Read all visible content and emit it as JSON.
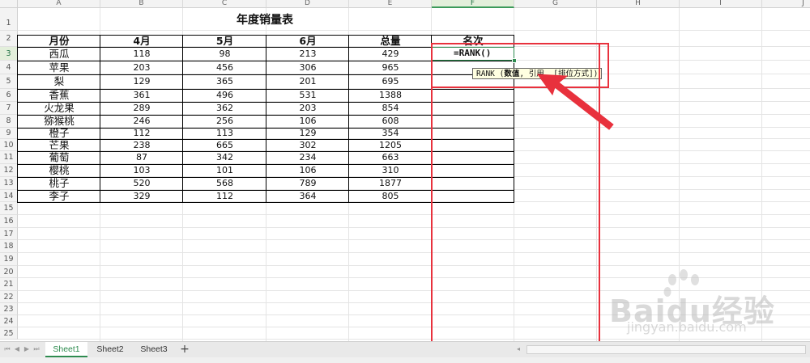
{
  "sheet": {
    "columns": [
      "A",
      "B",
      "C",
      "D",
      "E",
      "F",
      "G",
      "H",
      "I",
      "J"
    ],
    "rows": [
      "1",
      "2",
      "3",
      "4",
      "5",
      "6",
      "7",
      "8",
      "9",
      "10",
      "11",
      "12",
      "13",
      "14",
      "15",
      "16",
      "17",
      "18",
      "19",
      "20",
      "21",
      "22",
      "23",
      "24",
      "25"
    ],
    "selected_column": "F",
    "selected_row": "3"
  },
  "table": {
    "title": "年度销量表",
    "headers": [
      "月份",
      "4月",
      "5月",
      "6月",
      "总量",
      "名次"
    ],
    "rows": [
      [
        "西瓜",
        "118",
        "98",
        "213",
        "429"
      ],
      [
        "苹果",
        "203",
        "456",
        "306",
        "965"
      ],
      [
        "梨",
        "129",
        "365",
        "201",
        "695"
      ],
      [
        "香蕉",
        "361",
        "496",
        "531",
        "1388"
      ],
      [
        "火龙果",
        "289",
        "362",
        "203",
        "854"
      ],
      [
        "猕猴桃",
        "246",
        "256",
        "106",
        "608"
      ],
      [
        "橙子",
        "112",
        "113",
        "129",
        "354"
      ],
      [
        "芒果",
        "238",
        "665",
        "302",
        "1205"
      ],
      [
        "葡萄",
        "87",
        "342",
        "234",
        "663"
      ],
      [
        "樱桃",
        "103",
        "101",
        "106",
        "310"
      ],
      [
        "桃子",
        "520",
        "568",
        "789",
        "1877"
      ],
      [
        "李子",
        "329",
        "112",
        "364",
        "805"
      ]
    ]
  },
  "active_cell": {
    "formula": "=RANK()",
    "tooltip_prefix": "RANK (",
    "tooltip_arg1": "数值",
    "tooltip_rest": ", 引用, [排位方式])"
  },
  "tabs": {
    "items": [
      "Sheet1",
      "Sheet2",
      "Sheet3"
    ],
    "active": "Sheet1",
    "add_label": "+"
  },
  "watermark": {
    "brand": "Baidu经验",
    "url": "jingyan.baidu.com"
  },
  "colors": {
    "accent_green": "#2e8b4f",
    "highlight_red": "#e8313d",
    "tooltip_bg": "#ffffe1"
  }
}
